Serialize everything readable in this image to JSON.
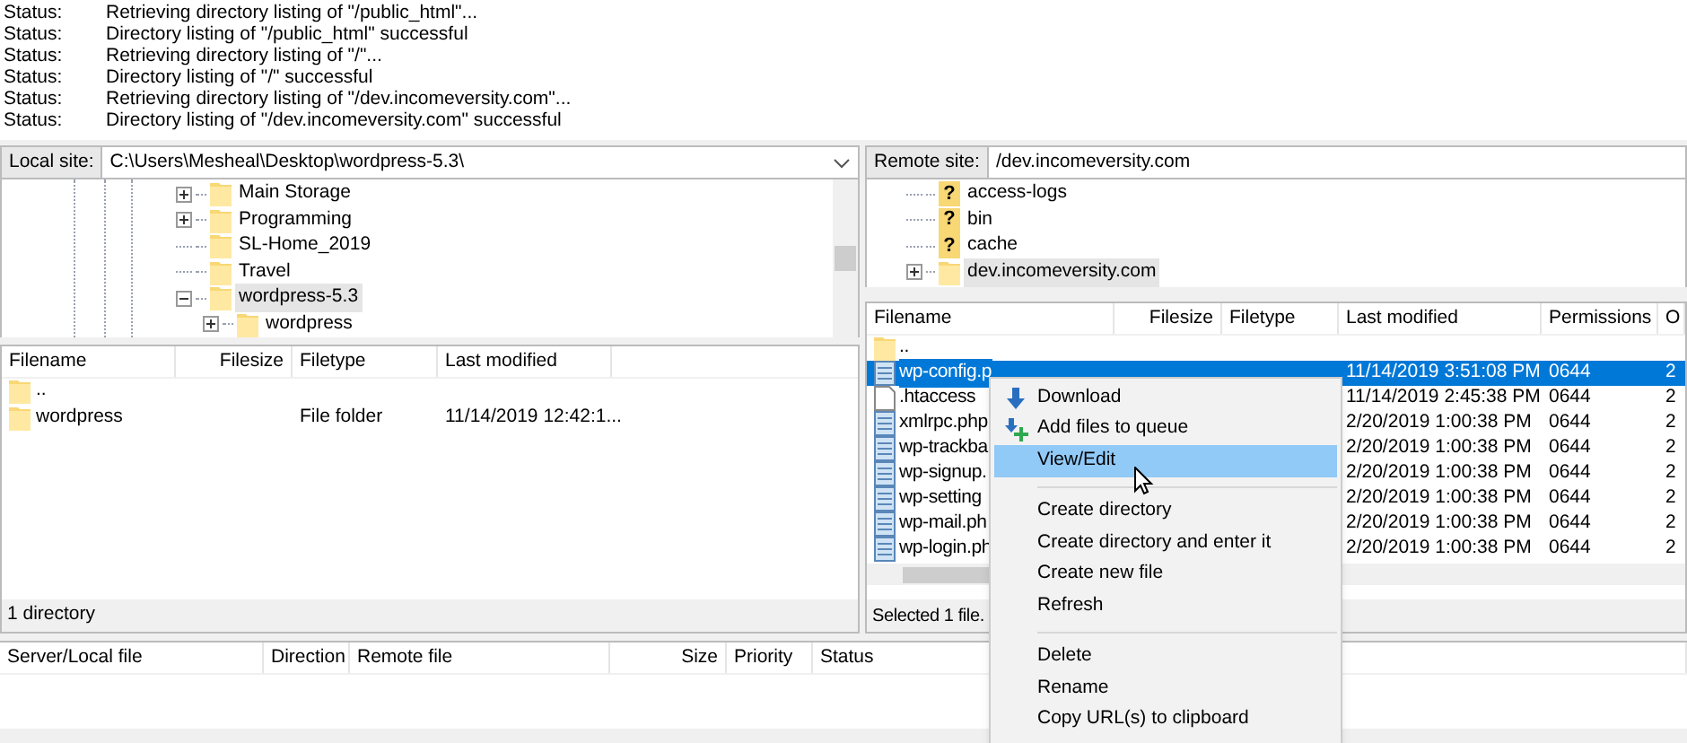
{
  "message_log": [
    {
      "label": "Status:",
      "text": "Retrieving directory listing of \"/public_html\"..."
    },
    {
      "label": "Status:",
      "text": "Directory listing of \"/public_html\" successful"
    },
    {
      "label": "Status:",
      "text": "Retrieving directory listing of \"/\"..."
    },
    {
      "label": "Status:",
      "text": "Directory listing of \"/\" successful"
    },
    {
      "label": "Status:",
      "text": "Retrieving directory listing of \"/dev.incomeversity.com\"..."
    },
    {
      "label": "Status:",
      "text": "Directory listing of \"/dev.incomeversity.com\" successful"
    }
  ],
  "local": {
    "site_label": "Local site:",
    "path": "C:\\Users\\Mesheal\\Desktop\\wordpress-5.3\\",
    "tree": [
      {
        "name": "Main Storage",
        "kind": "folder",
        "expanded": false,
        "selected": false
      },
      {
        "name": "Programming",
        "kind": "folder",
        "expanded": false,
        "selected": false
      },
      {
        "name": "SL-Home_2019",
        "kind": "leaf",
        "selected": false
      },
      {
        "name": "Travel",
        "kind": "leaf",
        "selected": false
      },
      {
        "name": "wordpress-5.3",
        "kind": "folder",
        "expanded": true,
        "selected": true,
        "children": [
          {
            "name": "wordpress",
            "kind": "folder",
            "expanded": false,
            "selected": false
          }
        ]
      }
    ],
    "columns": [
      "Filename",
      "Filesize",
      "Filetype",
      "Last modified"
    ],
    "rows": [
      {
        "name": "..",
        "filetype": "",
        "modified": ""
      },
      {
        "name": "wordpress",
        "filetype": "File folder",
        "modified": "11/14/2019 12:42:1..."
      }
    ],
    "status": "1 directory"
  },
  "remote": {
    "site_label": "Remote site:",
    "path": "/dev.incomeversity.com",
    "tree": [
      {
        "name": "access-logs",
        "kind": "unknown",
        "mark": "?",
        "selected": false
      },
      {
        "name": "bin",
        "kind": "unknown",
        "mark": "?",
        "selected": false
      },
      {
        "name": "cache",
        "kind": "unknown",
        "mark": "?",
        "selected": false
      },
      {
        "name": "dev.incomeversity.com",
        "kind": "folder",
        "selected": true
      }
    ],
    "columns": [
      "Filename",
      "Filesize",
      "Filetype",
      "Last modified",
      "Permissions",
      "O"
    ],
    "rows": [
      {
        "name": "..",
        "kind": "folder",
        "selected": false
      },
      {
        "name": "wp-config.p",
        "kind": "php",
        "selected": true,
        "modified": "11/14/2019 3:51:08 PM",
        "permissions": "0644",
        "column_6": "2"
      },
      {
        "name": ".htaccess",
        "kind": "file",
        "selected": false,
        "modified": "11/14/2019 2:45:38 PM",
        "permissions": "0644",
        "column_6": "2"
      },
      {
        "name": "xmlrpc.php",
        "kind": "php",
        "selected": false,
        "modified": "2/20/2019 1:00:38 PM",
        "permissions": "0644",
        "column_6": "2"
      },
      {
        "name": "wp-trackba",
        "kind": "php",
        "selected": false,
        "modified": "2/20/2019 1:00:38 PM",
        "permissions": "0644",
        "column_6": "2"
      },
      {
        "name": "wp-signup.",
        "kind": "php",
        "selected": false,
        "modified": "2/20/2019 1:00:38 PM",
        "permissions": "0644",
        "column_6": "2"
      },
      {
        "name": "wp-setting",
        "kind": "php",
        "selected": false,
        "modified": "2/20/2019 1:00:38 PM",
        "permissions": "0644",
        "column_6": "2"
      },
      {
        "name": "wp-mail.ph",
        "kind": "php",
        "selected": false,
        "modified": "2/20/2019 1:00:38 PM",
        "permissions": "0644",
        "column_6": "2"
      },
      {
        "name": "wp-login.ph",
        "kind": "php",
        "selected": false,
        "modified": "2/20/2019 1:00:38 PM",
        "permissions": "0644",
        "column_6": "2"
      }
    ],
    "status": "Selected 1 file."
  },
  "queue": {
    "columns": [
      "Server/Local file",
      "Direction",
      "Remote file",
      "Size",
      "Priority",
      "Status"
    ]
  },
  "context_menu": [
    {
      "kind": "item",
      "label": "Download",
      "highlighted": false
    },
    {
      "kind": "item",
      "label": "Add files to queue",
      "highlighted": false
    },
    {
      "kind": "item",
      "label": "View/Edit",
      "highlighted": true
    },
    {
      "kind": "separator"
    },
    {
      "kind": "item",
      "label": "Create directory",
      "highlighted": false
    },
    {
      "kind": "item",
      "label": "Create directory and enter it",
      "highlighted": false
    },
    {
      "kind": "item",
      "label": "Create new file",
      "highlighted": false
    },
    {
      "kind": "item",
      "label": "Refresh",
      "highlighted": false
    },
    {
      "kind": "separator"
    },
    {
      "kind": "item",
      "label": "Delete",
      "highlighted": false
    },
    {
      "kind": "item",
      "label": "Rename",
      "highlighted": false
    },
    {
      "kind": "item",
      "label": "Copy URL(s) to clipboard",
      "highlighted": false
    }
  ]
}
